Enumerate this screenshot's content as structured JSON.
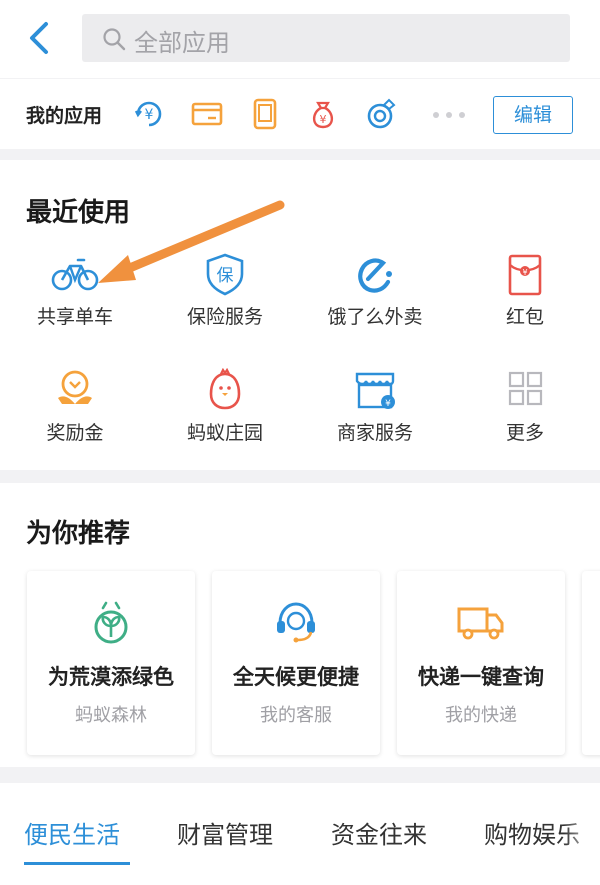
{
  "header": {
    "search_placeholder": "全部应用"
  },
  "my_apps": {
    "label": "我的应用",
    "icons": [
      "yuan-circle-icon",
      "card-icon",
      "phone-icon",
      "money-bag-icon",
      "ring-icon"
    ],
    "more_glyph": "···",
    "edit_label": "编辑"
  },
  "recent": {
    "title": "最近使用",
    "apps": [
      {
        "name": "共享单车",
        "icon": "bicycle-icon"
      },
      {
        "name": "保险服务",
        "icon": "insurance-shield-icon"
      },
      {
        "name": "饿了么外卖",
        "icon": "eleme-icon"
      },
      {
        "name": "红包",
        "icon": "red-packet-icon"
      },
      {
        "name": "奖励金",
        "icon": "reward-icon"
      },
      {
        "name": "蚂蚁庄园",
        "icon": "chick-icon"
      },
      {
        "name": "商家服务",
        "icon": "shop-icon"
      },
      {
        "name": "更多",
        "icon": "grid-more-icon"
      }
    ]
  },
  "recommend": {
    "title": "为你推荐",
    "cards": [
      {
        "title": "为荒漠添绿色",
        "subtitle": "蚂蚁森林",
        "icon": "sprout-icon"
      },
      {
        "title": "全天候更便捷",
        "subtitle": "我的客服",
        "icon": "headset-icon"
      },
      {
        "title": "快递一键查询",
        "subtitle": "我的快递",
        "icon": "truck-icon"
      }
    ]
  },
  "tabs": [
    "便民生活",
    "财富管理",
    "资金往来",
    "购物娱乐"
  ],
  "colors": {
    "accent": "#2d8fd8",
    "orange": "#f5a23c",
    "red": "#e8544b",
    "green": "#3fae86",
    "annotation_arrow": "#f0913e"
  }
}
